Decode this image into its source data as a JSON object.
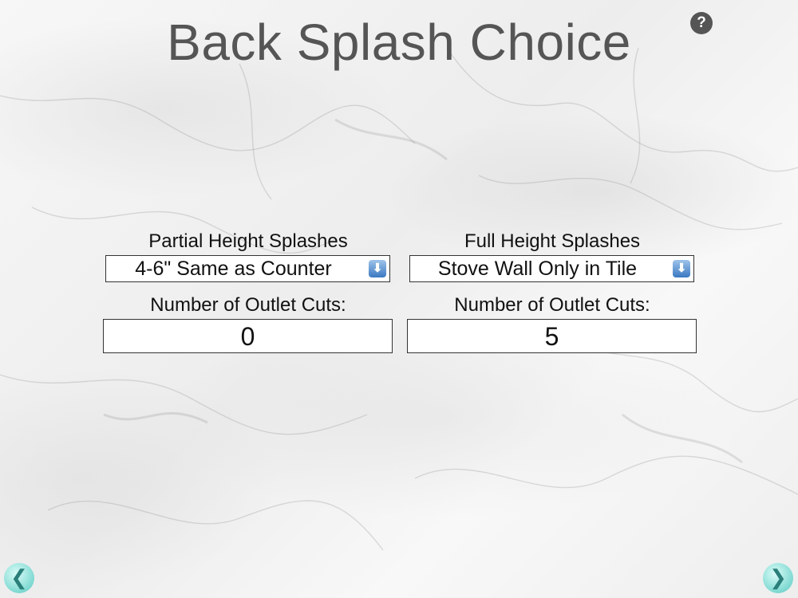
{
  "title": "Back Splash Choice",
  "help": "?",
  "partial": {
    "label": "Partial Height Splashes",
    "selected": "4-6\" Same as Counter",
    "outlet_label": "Number of Outlet Cuts:",
    "outlet_value": "0"
  },
  "full": {
    "label": "Full Height Splashes",
    "selected": "Stove Wall Only in Tile",
    "outlet_label": "Number of Outlet Cuts:",
    "outlet_value": "5"
  },
  "icons": {
    "dropdown": "arrow-down-icon",
    "back": "chevron-left-icon",
    "next": "chevron-right-icon"
  },
  "colors": {
    "accent_blue": "#3b78c2",
    "nav_teal": "#7ed9d2"
  }
}
